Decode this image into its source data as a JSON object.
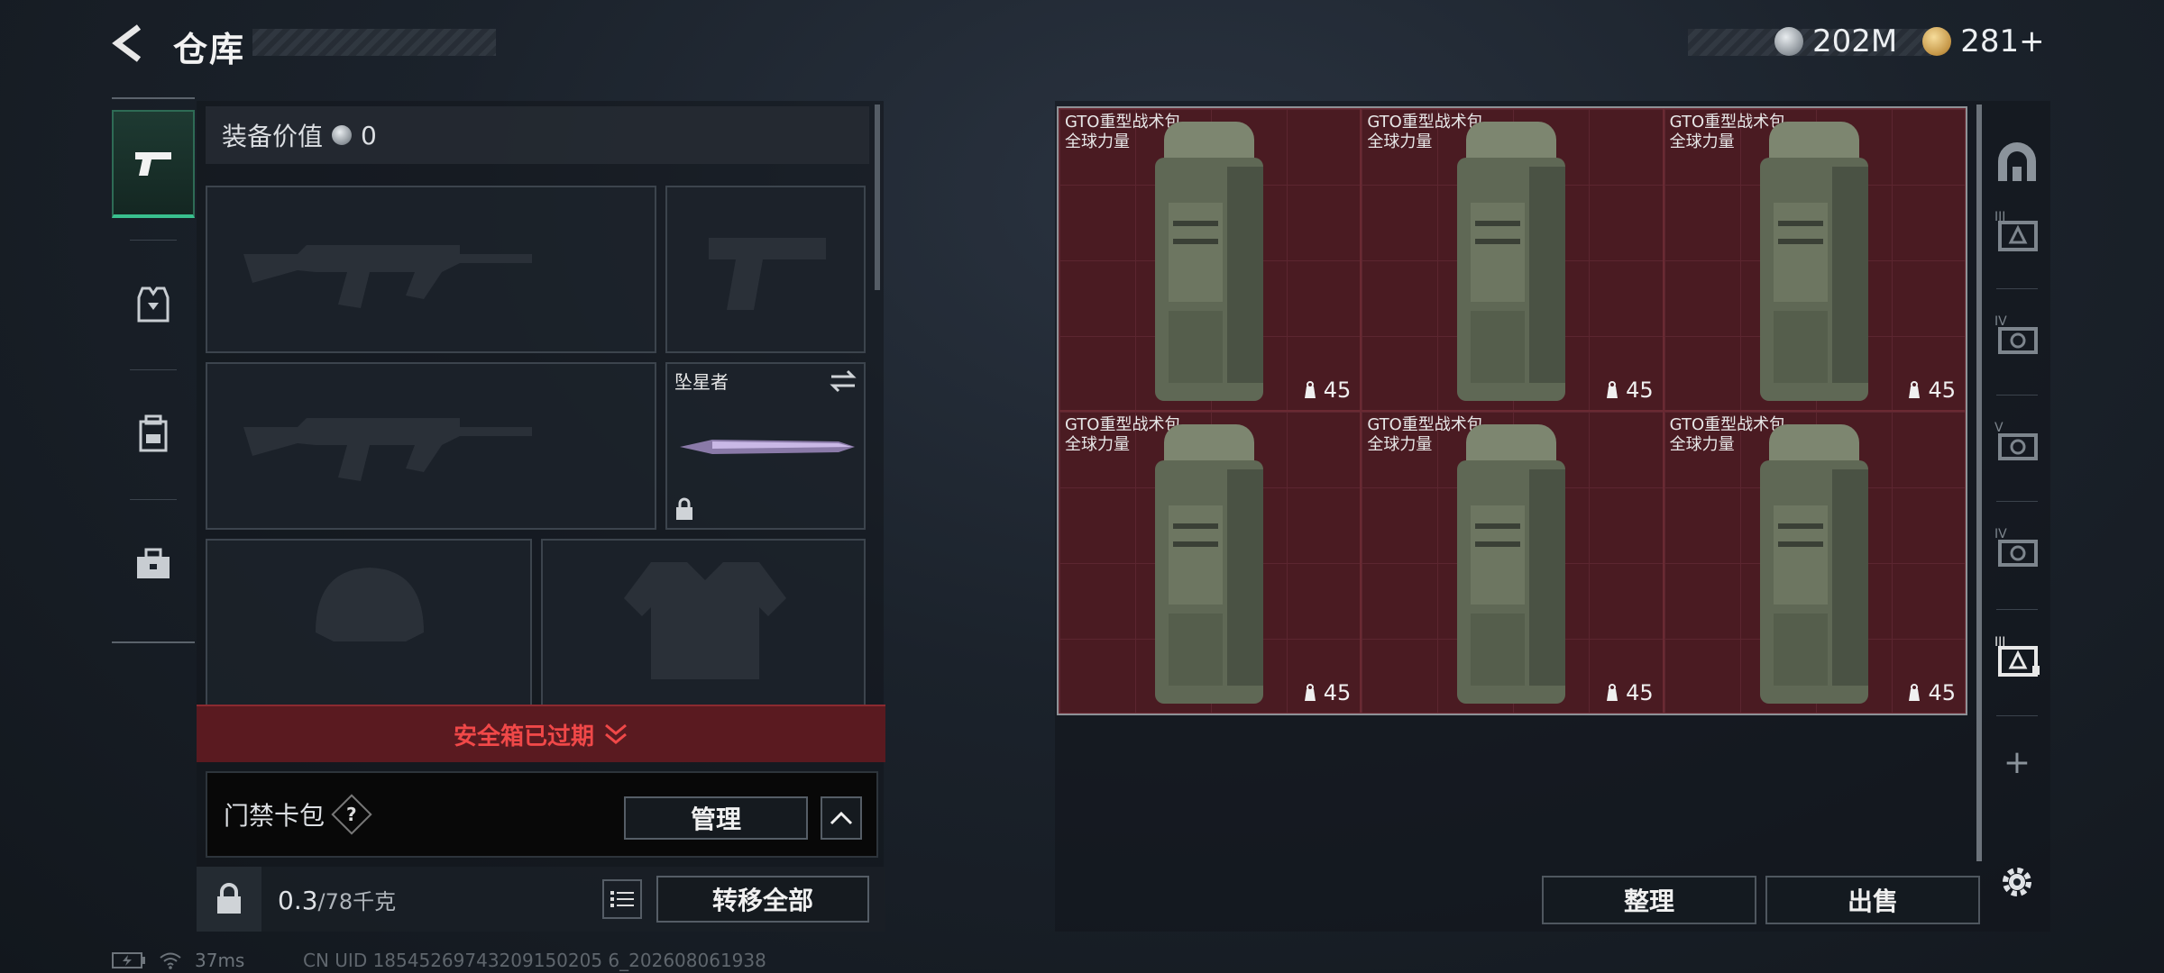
{
  "header": {
    "title": "仓库"
  },
  "currency": {
    "silver": "202M",
    "gold": "281+"
  },
  "equipment": {
    "value_label": "装备价值",
    "value": "0",
    "melee_name": "坠星者",
    "safebox_status": "安全箱已过期",
    "keycard_label": "门禁卡包",
    "help": "?",
    "manage_label": "管理",
    "weight_current": "0.3",
    "weight_max": "/78千克",
    "transfer_label": "转移全部"
  },
  "storage": {
    "items": [
      {
        "name": "GTO重型战术包",
        "faction": "全球力量",
        "count": "45"
      },
      {
        "name": "GTO重型战术包",
        "faction": "全球力量",
        "count": "45"
      },
      {
        "name": "GTO重型战术包",
        "faction": "全球力量",
        "count": "45"
      },
      {
        "name": "GTO重型战术包",
        "faction": "全球力量",
        "count": "45"
      },
      {
        "name": "GTO重型战术包",
        "faction": "全球力量",
        "count": "45"
      },
      {
        "name": "GTO重型战术包",
        "faction": "全球力量",
        "count": "45"
      }
    ],
    "sort_label": "整理",
    "sell_label": "出售",
    "add_label": "+"
  },
  "side_tools": {
    "case_levels": [
      "III",
      "IV",
      "V",
      "IV",
      "III"
    ]
  },
  "status": {
    "ping": "37ms",
    "uid": "CN UID 18545269743209150205 6_202608061938"
  },
  "colors": {
    "accent_green": "#39c08e",
    "expired_red": "#f04848",
    "grid_red": "#4a1b22"
  }
}
